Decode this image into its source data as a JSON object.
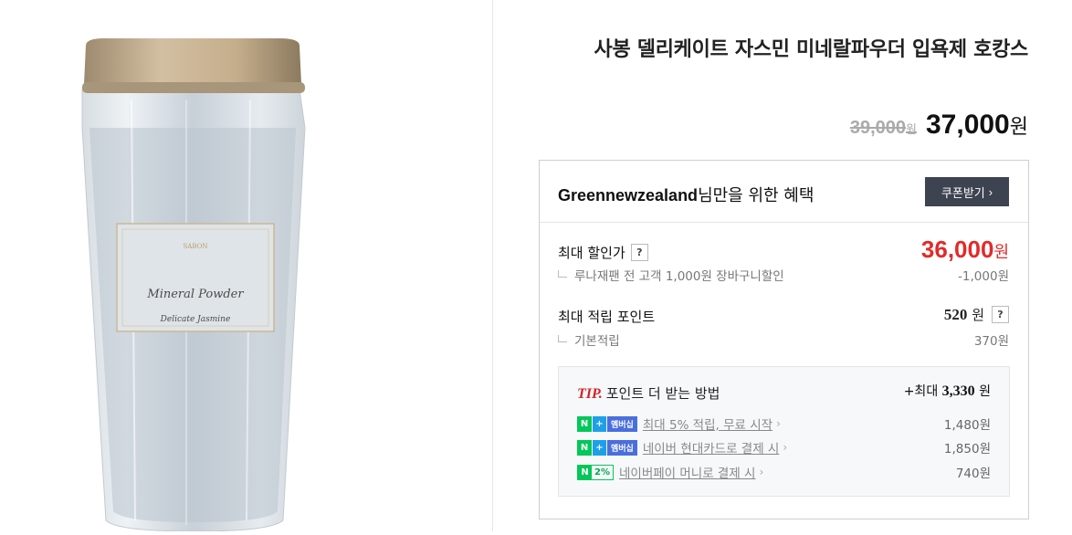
{
  "product": {
    "title": "사봉 델리케이트 자스민 미네랄파우더 입욕제 호캉스",
    "jar_label_line1": "Mineral Powder",
    "jar_label_line2": "Delicate Jasmine",
    "jar_brand": "SABON"
  },
  "price": {
    "original": "39,000",
    "original_unit": "원",
    "sale": "37,000",
    "sale_unit": "원"
  },
  "benefit": {
    "user": "Greennewzealand",
    "header_suffix": "님만을 위한 혜택",
    "coupon_button": "쿠폰받기",
    "max_discount_label": "최대 할인가",
    "max_discount_price": "36,000",
    "max_discount_unit": "원",
    "discount_detail": "루나재팬 전 고객 1,000원 장바구니할인",
    "discount_detail_value": "-1,000원",
    "max_points_label": "최대 적립 포인트",
    "max_points_value": "520",
    "max_points_unit": "원",
    "base_points_label": "기본적립",
    "base_points_value": "370원",
    "help_icon": "?"
  },
  "tip": {
    "tag": "TIP.",
    "title": "포인트 더 받는 방법",
    "max_prefix": "+최대",
    "max_value": "3,330",
    "max_unit": "원",
    "items": [
      {
        "badge": "멤버십",
        "label": "최대 5% 적립, 무료 시작",
        "value": "1,480원"
      },
      {
        "badge": "멤버십",
        "label": "네이버 현대카드로 결제 시",
        "value": "1,850원"
      },
      {
        "badge": "2%",
        "label": "네이버페이 머니로 결제 시",
        "value": "740원"
      }
    ]
  },
  "colors": {
    "accent_red": "#e22a2a",
    "naver_green": "#03c75a",
    "coupon_bg": "#3d4350"
  }
}
